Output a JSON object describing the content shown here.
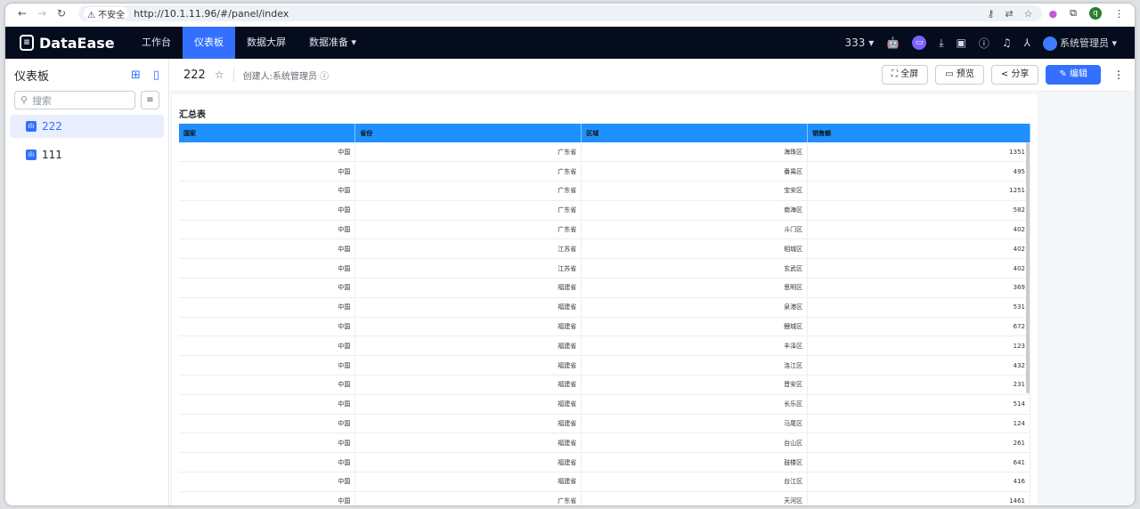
{
  "browser": {
    "security": "不安全",
    "url": "http://10.1.11.96/#/panel/index",
    "profile_initial": "q"
  },
  "nav": {
    "brand": "DataEase",
    "menus": [
      "工作台",
      "仪表板",
      "数据大屏",
      "数据准备"
    ],
    "active_index": 1,
    "org": "333",
    "user": "系统管理员"
  },
  "sidebar": {
    "title": "仪表板",
    "search_placeholder": "搜索",
    "items": [
      {
        "label": "222",
        "selected": true
      },
      {
        "label": "111",
        "selected": false
      }
    ]
  },
  "header": {
    "title": "222",
    "creator": "创建人:系统管理员",
    "buttons": {
      "fullscreen": "全屏",
      "preview": "预览",
      "share": "分享",
      "edit": "编辑"
    }
  },
  "table": {
    "title": "汇总表",
    "header_color": "#1e90ff",
    "columns": [
      "国家",
      "省份",
      "区域",
      "销售额"
    ],
    "rows": [
      [
        "中国",
        "广东省",
        "海珠区",
        "1351"
      ],
      [
        "中国",
        "广东省",
        "番禺区",
        "495"
      ],
      [
        "中国",
        "广东省",
        "宝安区",
        "1251"
      ],
      [
        "中国",
        "广东省",
        "南海区",
        "582"
      ],
      [
        "中国",
        "广东省",
        "斗门区",
        "402"
      ],
      [
        "中国",
        "江苏省",
        "相城区",
        "402"
      ],
      [
        "中国",
        "江苏省",
        "玄武区",
        "402"
      ],
      [
        "中国",
        "福建省",
        "思明区",
        "369"
      ],
      [
        "中国",
        "福建省",
        "泉港区",
        "531"
      ],
      [
        "中国",
        "福建省",
        "鲤城区",
        "672"
      ],
      [
        "中国",
        "福建省",
        "丰泽区",
        "123"
      ],
      [
        "中国",
        "福建省",
        "洛江区",
        "432"
      ],
      [
        "中国",
        "福建省",
        "晋安区",
        "231"
      ],
      [
        "中国",
        "福建省",
        "长乐区",
        "514"
      ],
      [
        "中国",
        "福建省",
        "马尾区",
        "124"
      ],
      [
        "中国",
        "福建省",
        "台山区",
        "261"
      ],
      [
        "中国",
        "福建省",
        "鼓楼区",
        "641"
      ],
      [
        "中国",
        "福建省",
        "台江区",
        "416"
      ],
      [
        "中国",
        "广东省",
        "天河区",
        "1461"
      ]
    ]
  }
}
